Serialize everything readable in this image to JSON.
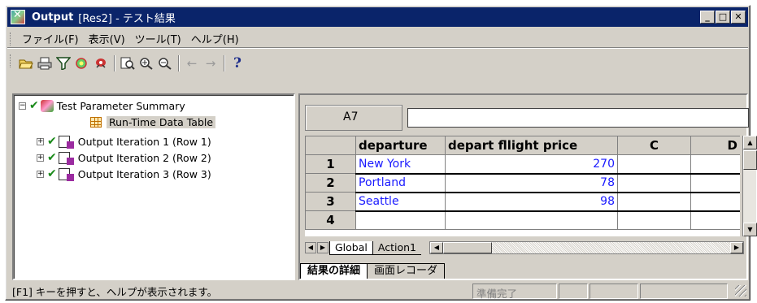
{
  "window": {
    "title_strong": "Output",
    "title_rest": "[Res2] - テスト結果",
    "minimize": "_",
    "maximize": "□",
    "close": "✕"
  },
  "menu": [
    "ファイル(F)",
    "表示(V)",
    "ツール(T)",
    "ヘルプ(H)"
  ],
  "toolbar": {
    "icons": [
      "open-folder-icon",
      "print-icon",
      "filter-icon",
      "find-icon",
      "bug-icon",
      "zoom-page-icon",
      "zoom-in-icon",
      "zoom-out-icon",
      "back-arrow-icon",
      "forward-arrow-icon",
      "help-icon"
    ],
    "back": "←",
    "forward": "→",
    "help": "?"
  },
  "tree": {
    "root_label": "Test Parameter Summary",
    "runtime_label": "Run-Time Data Table",
    "iterations": [
      "Output Iteration 1 (Row 1)",
      "Output Iteration 2 (Row 2)",
      "Output Iteration 3 (Row 3)"
    ]
  },
  "sheet": {
    "cell_ref": "A7",
    "formula": "",
    "columns": [
      "departure",
      "depart",
      "fllight",
      "price",
      "C",
      "D"
    ],
    "rows": [
      {
        "num": "1",
        "departure": "New York",
        "price": "270"
      },
      {
        "num": "2",
        "departure": "Portland",
        "price": "78"
      },
      {
        "num": "3",
        "departure": "Seattle",
        "price": "98"
      },
      {
        "num": "4",
        "departure": "",
        "price": ""
      }
    ],
    "tabs": [
      "Global",
      "Action1"
    ]
  },
  "bottom_tabs": [
    "結果の詳細",
    "画面レコーダ"
  ],
  "status": {
    "message": "[F1] キーを押すと、ヘルプが表示されます。",
    "state": "準備完了"
  },
  "colors": {
    "title_bg": "#0a246a",
    "value_text": "#1a1aff",
    "check_green": "#1a8a1a"
  }
}
